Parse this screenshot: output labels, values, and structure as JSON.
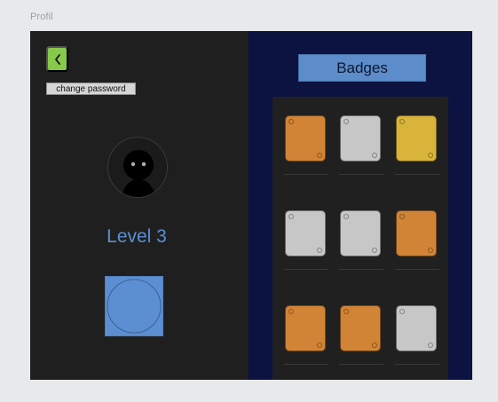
{
  "window": {
    "title": "Profil"
  },
  "profile": {
    "change_password_label": "change password",
    "level_label": "Level 3",
    "back_icon": "chevron-left-icon",
    "avatar_icon": "user-avatar-icon",
    "level_badge_icon": "level-badge-icon"
  },
  "badges": {
    "title": "Badges",
    "items": [
      {
        "color": "#d18435"
      },
      {
        "color": "#c7c7c7"
      },
      {
        "color": "#d8b43a"
      },
      {
        "color": "#c7c7c7"
      },
      {
        "color": "#c7c7c7"
      },
      {
        "color": "#d18435"
      },
      {
        "color": "#d18435"
      },
      {
        "color": "#d18435"
      },
      {
        "color": "#c7c7c7"
      }
    ]
  },
  "colors": {
    "page_bg": "#e8e9ea",
    "left_panel_bg": "#1f1f1f",
    "right_panel_bg": "#0c1340",
    "accent_blue": "#5b8fd1",
    "back_button_green": "#88c84a"
  }
}
